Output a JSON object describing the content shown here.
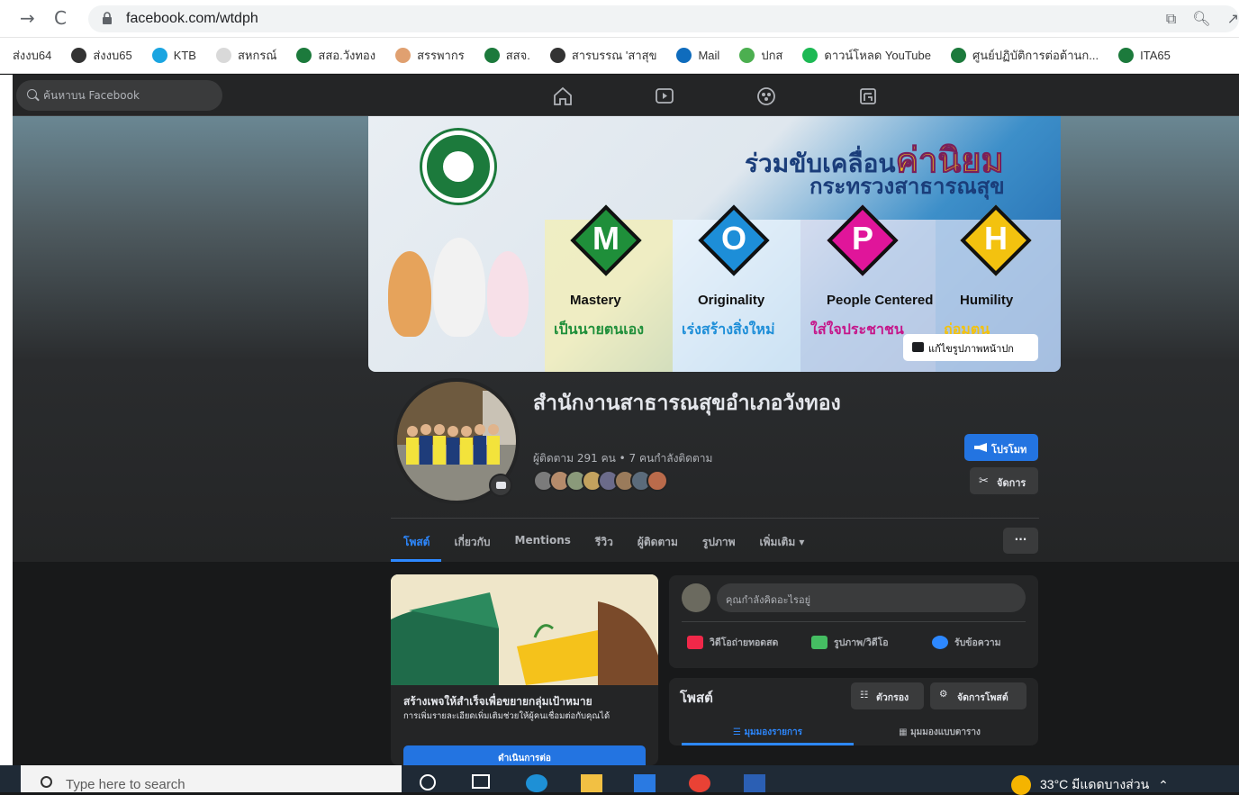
{
  "browser": {
    "url": "facebook.com/wtdph",
    "back_icon": "arrow-right-icon",
    "reload_icon": "reload-icon"
  },
  "bookmarks": [
    {
      "label": "ส่งงบ64",
      "color": ""
    },
    {
      "label": "ส่งงบ65",
      "color": "#333333"
    },
    {
      "label": "KTB",
      "color": "#1ba5e1"
    },
    {
      "label": "สหกรณ์",
      "color": "#d9d9d9"
    },
    {
      "label": "สสอ.วังทอง",
      "color": "#1c7a3c"
    },
    {
      "label": "สรรพากร",
      "color": "#e0a070"
    },
    {
      "label": "สสจ.",
      "color": "#1c7a3c"
    },
    {
      "label": "สารบรรณ 'สาสุข",
      "color": "#333333"
    },
    {
      "label": "Mail",
      "color": "#0f6cbd"
    },
    {
      "label": "ปกส",
      "color": "#4caf50"
    },
    {
      "label": "ดาวน์โหลด YouTube",
      "color": "#1db954"
    },
    {
      "label": "ศูนย์ปฏิบัติการต่อต้านก...",
      "color": "#1c7a3c"
    },
    {
      "label": "ITA65",
      "color": "#1c7a3c"
    }
  ],
  "fb": {
    "search_placeholder": "ค้นหาบน Facebook",
    "cover": {
      "headline_prefix": "ร่วมขับเคลื่อน",
      "headline_emph": "ค่านิยม",
      "headline_2": "กระทรวงสาธารณสุข",
      "values": [
        {
          "letter": "M",
          "title": "Mastery",
          "thai": "เป็นนายตนเอง",
          "color": "#1f8f3a",
          "thai_color": "#1f8f3a"
        },
        {
          "letter": "O",
          "title": "Originality",
          "thai": "เร่งสร้างสิ่งใหม่",
          "color": "#1d8ed8",
          "thai_color": "#1d8ed8"
        },
        {
          "letter": "P",
          "title": "People Centered",
          "thai": "ใส่ใจประชาชน",
          "color": "#e0159a",
          "thai_color": "#c5168a"
        },
        {
          "letter": "H",
          "title": "Humility",
          "thai": "ถ่อมตน",
          "color": "#f3c20f",
          "thai_color": "#f3c20f"
        }
      ],
      "edit_label": "แก้ไขรูปภาพหน้าปก"
    },
    "page": {
      "name": "สำนักงานสาธารณสุขอำเภอวังทอง",
      "followers": "ผู้ติดตาม 291 คน • 7 คนกำลังติดตาม"
    },
    "buttons": {
      "promote": "โปรโมท",
      "manage": "จัดการ",
      "more": "···"
    },
    "tabs": [
      "โพสต์",
      "เกี่ยวกับ",
      "Mentions",
      "รีวิว",
      "ผู้ติดตาม",
      "รูปภาพ",
      "เพิ่มเติม ▾"
    ],
    "left_card": {
      "title": "สร้างเพจให้สำเร็จเพื่อขยายกลุ่มเป้าหมาย",
      "desc": "การเพิ่มรายละเอียดเพิ่มเติมช่วยให้ผู้คนเชื่อมต่อกับคุณได้",
      "button": "ดำเนินการต่อ"
    },
    "composer": {
      "placeholder": "คุณกำลังคิดอะไรอยู่",
      "actions": [
        "วิดีโอถ่ายทอดสด",
        "รูปภาพ/วิดีโอ",
        "รับข้อความ"
      ]
    },
    "posts": {
      "heading": "โพสต์",
      "filter": "ตัวกรอง",
      "manage": "จัดการโพสต์",
      "list_view": "☰ มุมมองรายการ",
      "grid_view": "มุมมองแบบตาราง"
    }
  },
  "taskbar": {
    "search_placeholder": "Type here to search",
    "weather": "33°C  มีแดดบางส่วน"
  }
}
